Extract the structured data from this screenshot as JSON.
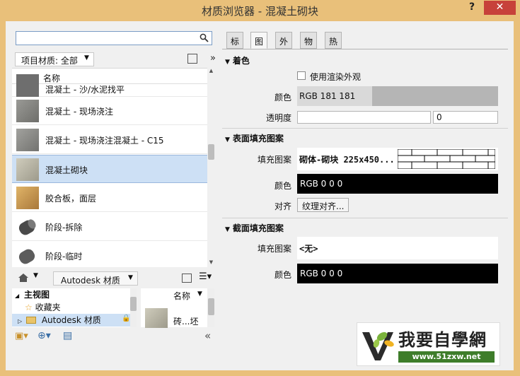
{
  "window": {
    "title": "材质浏览器 - 混凝土砌块",
    "help": "?",
    "close": "✕"
  },
  "search": {
    "placeholder": ""
  },
  "library_bar": {
    "project_materials": "项目材质: 全部",
    "more": "»"
  },
  "list": {
    "header": "名称",
    "items": [
      {
        "name": "混凝土 - 沙/水泥找平",
        "color": "#6e6e6e"
      },
      {
        "name": "混凝土 - 现场浇注",
        "color": "#8a8a86"
      },
      {
        "name": "混凝土 - 现场浇注混凝土 - C15",
        "color": "#8f8f8b"
      },
      {
        "name": "混凝土砌块",
        "color": "#b6b3a4"
      },
      {
        "name": "胶合板，面层",
        "color": "#c89c54"
      },
      {
        "name": "阶段-拆除",
        "color": "#5a5a5a"
      },
      {
        "name": "阶段-临时",
        "color": "#707070"
      }
    ]
  },
  "library_nav": {
    "crumb": "Autodesk 材质"
  },
  "tree": {
    "root": "主视图",
    "favorites": "收藏夹",
    "autodesk": "Autodesk 材质"
  },
  "grid2": {
    "header": "名称",
    "item": "砖...坯"
  },
  "tabs": [
    "标识",
    "图形",
    "外观",
    "物理",
    "热度"
  ],
  "shading": {
    "title": "着色",
    "use_render": "使用渲染外观",
    "color_label": "颜色",
    "color_value": "RGB 181 181 181",
    "color_hex": "#b5b5b5",
    "transparency_label": "透明度",
    "transparency_value": "0"
  },
  "surface": {
    "title": "表面填充图案",
    "fill_label": "填充图案",
    "fill_value": "砌体-砌块 225x450...",
    "color_label": "颜色",
    "color_value": "RGB 0 0 0",
    "align_label": "对齐",
    "align_button": "纹理对齐..."
  },
  "cut": {
    "title": "截面填充图案",
    "fill_label": "填充图案",
    "fill_value": "<无>",
    "color_label": "颜色",
    "color_value": "RGB 0 0 0"
  },
  "watermark": {
    "text": "我要自學網",
    "url": "www.51zxw.net"
  }
}
